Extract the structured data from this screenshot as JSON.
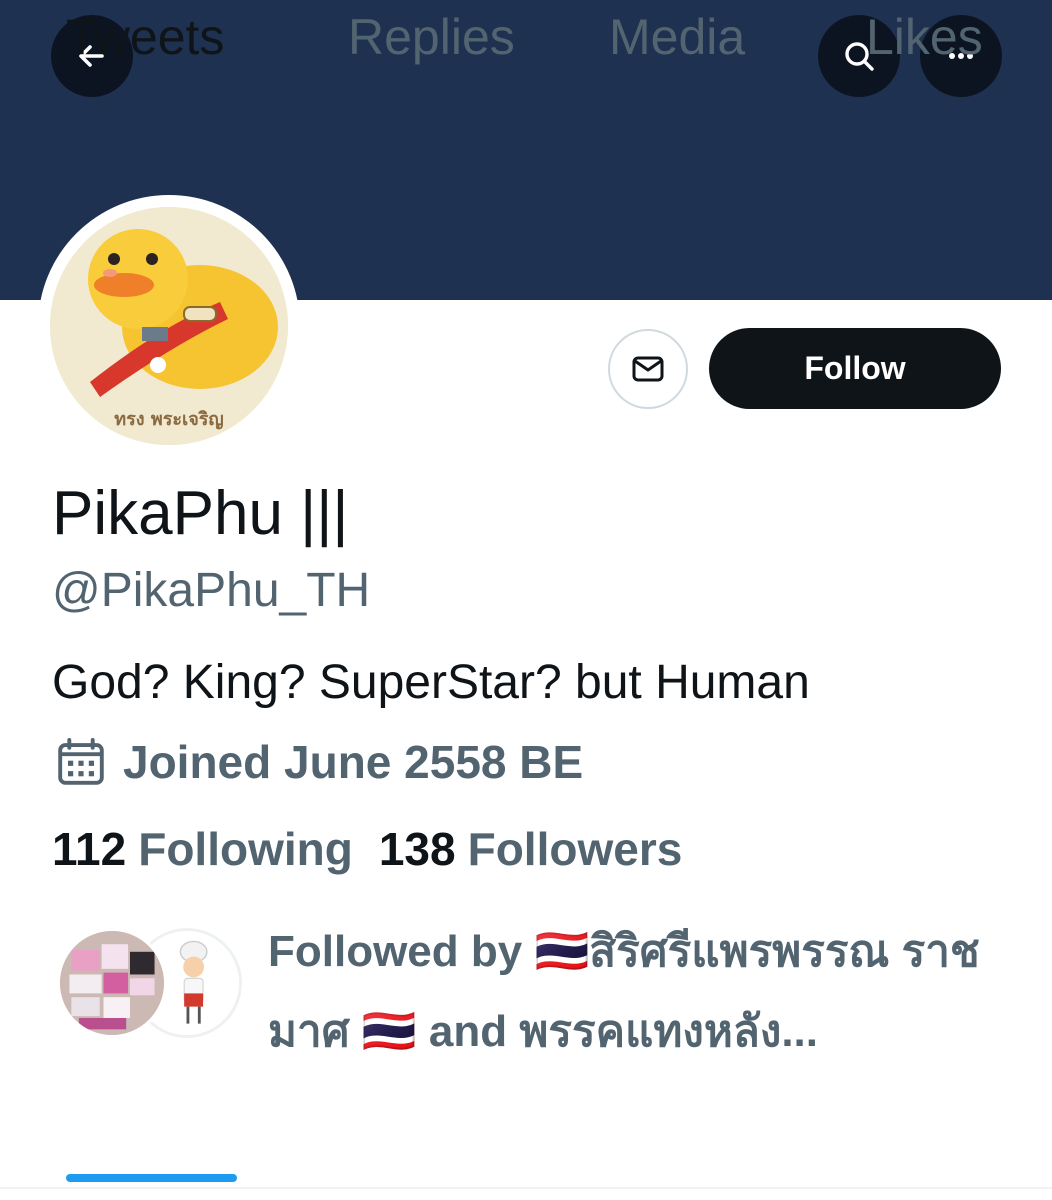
{
  "colors": {
    "banner": "#1f3150",
    "accent": "#1d9bf0",
    "primary_text": "#0f1419",
    "secondary_text": "#536471"
  },
  "header": {
    "back_icon": "arrow-left-icon",
    "search_icon": "search-icon",
    "more_icon": "more-horizontal-icon"
  },
  "profile": {
    "avatar_caption": "ทรง พระเจริญ",
    "display_name": "PikaPhu |||",
    "handle": "@PikaPhu_TH",
    "bio": "God? King? SuperStar? but Human",
    "joined_icon": "calendar-icon",
    "joined": "Joined June 2558 BE",
    "following_count": "112",
    "following_label": "Following",
    "followers_count": "138",
    "followers_label": "Followers",
    "followed_by": "Followed by 🇹🇭สิริศรีแพรพรรณ ราชมาศ 🇹🇭 and พรรคแทงหลัง..."
  },
  "actions": {
    "message_icon": "envelope-icon",
    "follow_label": "Follow"
  },
  "tabs": [
    {
      "label": "Tweets",
      "active": true
    },
    {
      "label": "Replies",
      "active": false
    },
    {
      "label": "Media",
      "active": false
    },
    {
      "label": "Likes",
      "active": false
    }
  ]
}
